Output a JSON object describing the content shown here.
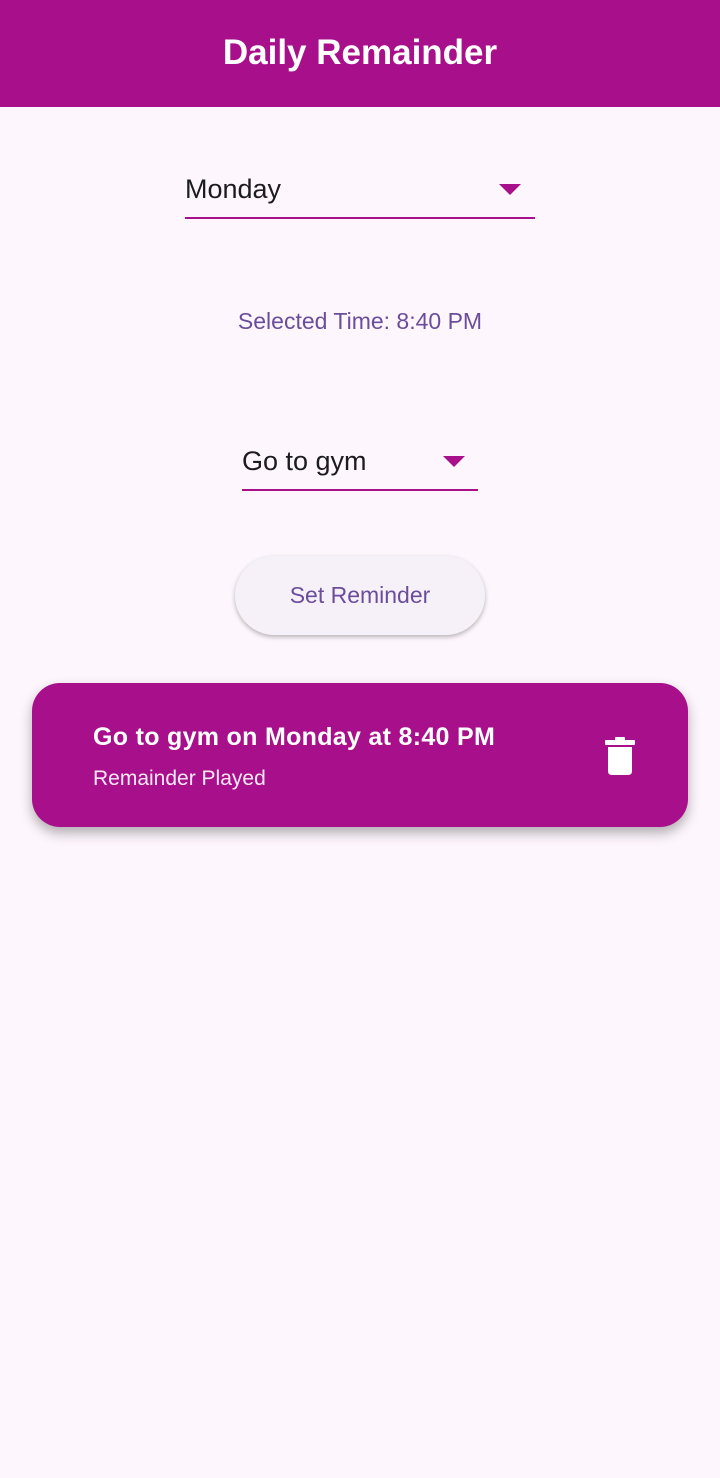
{
  "app_bar": {
    "title": "Daily Remainder"
  },
  "day_dropdown": {
    "value": "Monday"
  },
  "selected_time": {
    "text": "Selected Time: 8:40 PM"
  },
  "task_dropdown": {
    "value": "Go to gym"
  },
  "set_button": {
    "label": "Set Reminder"
  },
  "reminders": [
    {
      "title": "Go to gym on Monday at 8:40 PM",
      "subtitle": "Remainder Played",
      "icon": "delete-icon"
    }
  ],
  "colors": {
    "primary": "#a8108b",
    "background": "#fdf6fc",
    "accent_text": "#6b4e9b"
  }
}
